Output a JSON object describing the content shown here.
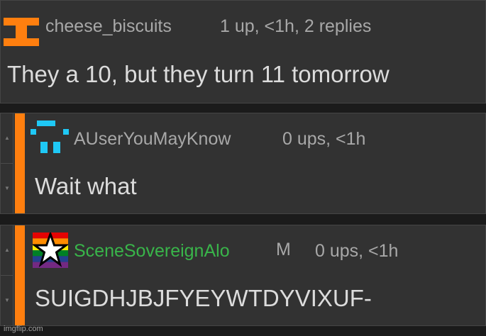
{
  "comments": [
    {
      "username": "cheese_biscuits",
      "meta": "1 up, <1h, 2 replies",
      "text": "They a 10, but they turn 11 tomorrow",
      "avatar": "orange-i-beam-icon",
      "accent": "#ff7f0f"
    },
    {
      "username": "AUserYouMayKnow",
      "meta": "0 ups, <1h",
      "text": "Wait what",
      "avatar": "cyan-pixel-face-icon",
      "accent": "#1fc8f5"
    },
    {
      "username": "SceneSovereignAlo",
      "badge": "M",
      "meta": "0 ups, <1h",
      "text": "SUIGDHJBJFYEYWTDYVIXUF-",
      "avatar": "rainbow-star-icon",
      "username_color": "#39b54a"
    }
  ],
  "vote_up": "▲",
  "vote_down": "▼",
  "watermark": "imgflip.com"
}
